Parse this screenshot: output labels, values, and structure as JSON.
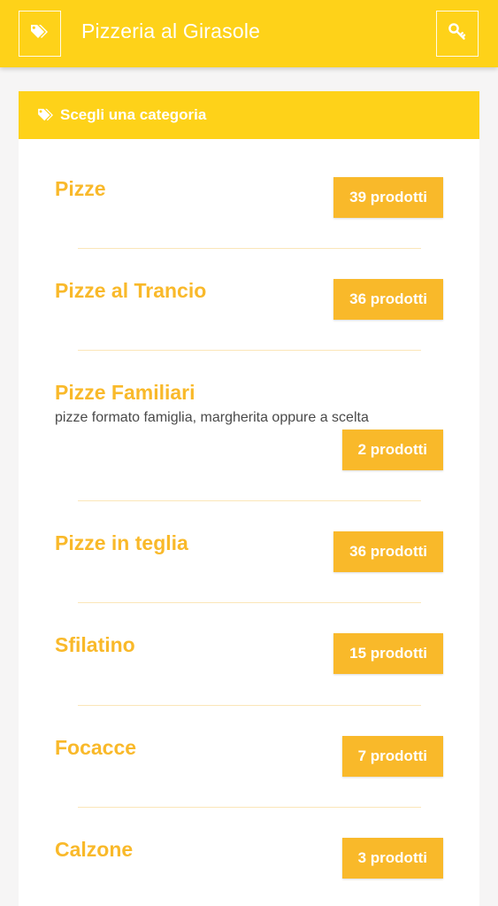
{
  "header": {
    "title": "Pizzeria al Girasole",
    "left_icon": "tags-icon",
    "right_icon": "key-icon"
  },
  "panel": {
    "title": "Scegli una categoria",
    "icon": "tags-icon"
  },
  "categories": [
    {
      "name": "Pizze",
      "description": "",
      "count": "39 prodotti"
    },
    {
      "name": "Pizze al Trancio",
      "description": "",
      "count": "36 prodotti"
    },
    {
      "name": "Pizze Familiari",
      "description": "pizze formato famiglia, margherita oppure a scelta",
      "count": "2 prodotti"
    },
    {
      "name": "Pizze in teglia",
      "description": "",
      "count": "36 prodotti"
    },
    {
      "name": "Sfilatino",
      "description": "",
      "count": "15 prodotti"
    },
    {
      "name": "Focacce",
      "description": "",
      "count": "7 prodotti"
    },
    {
      "name": "Calzone",
      "description": "",
      "count": "3 prodotti"
    }
  ],
  "colors": {
    "primary": "#fed219",
    "accent": "#f9b92a",
    "background": "#f6f5f5"
  }
}
